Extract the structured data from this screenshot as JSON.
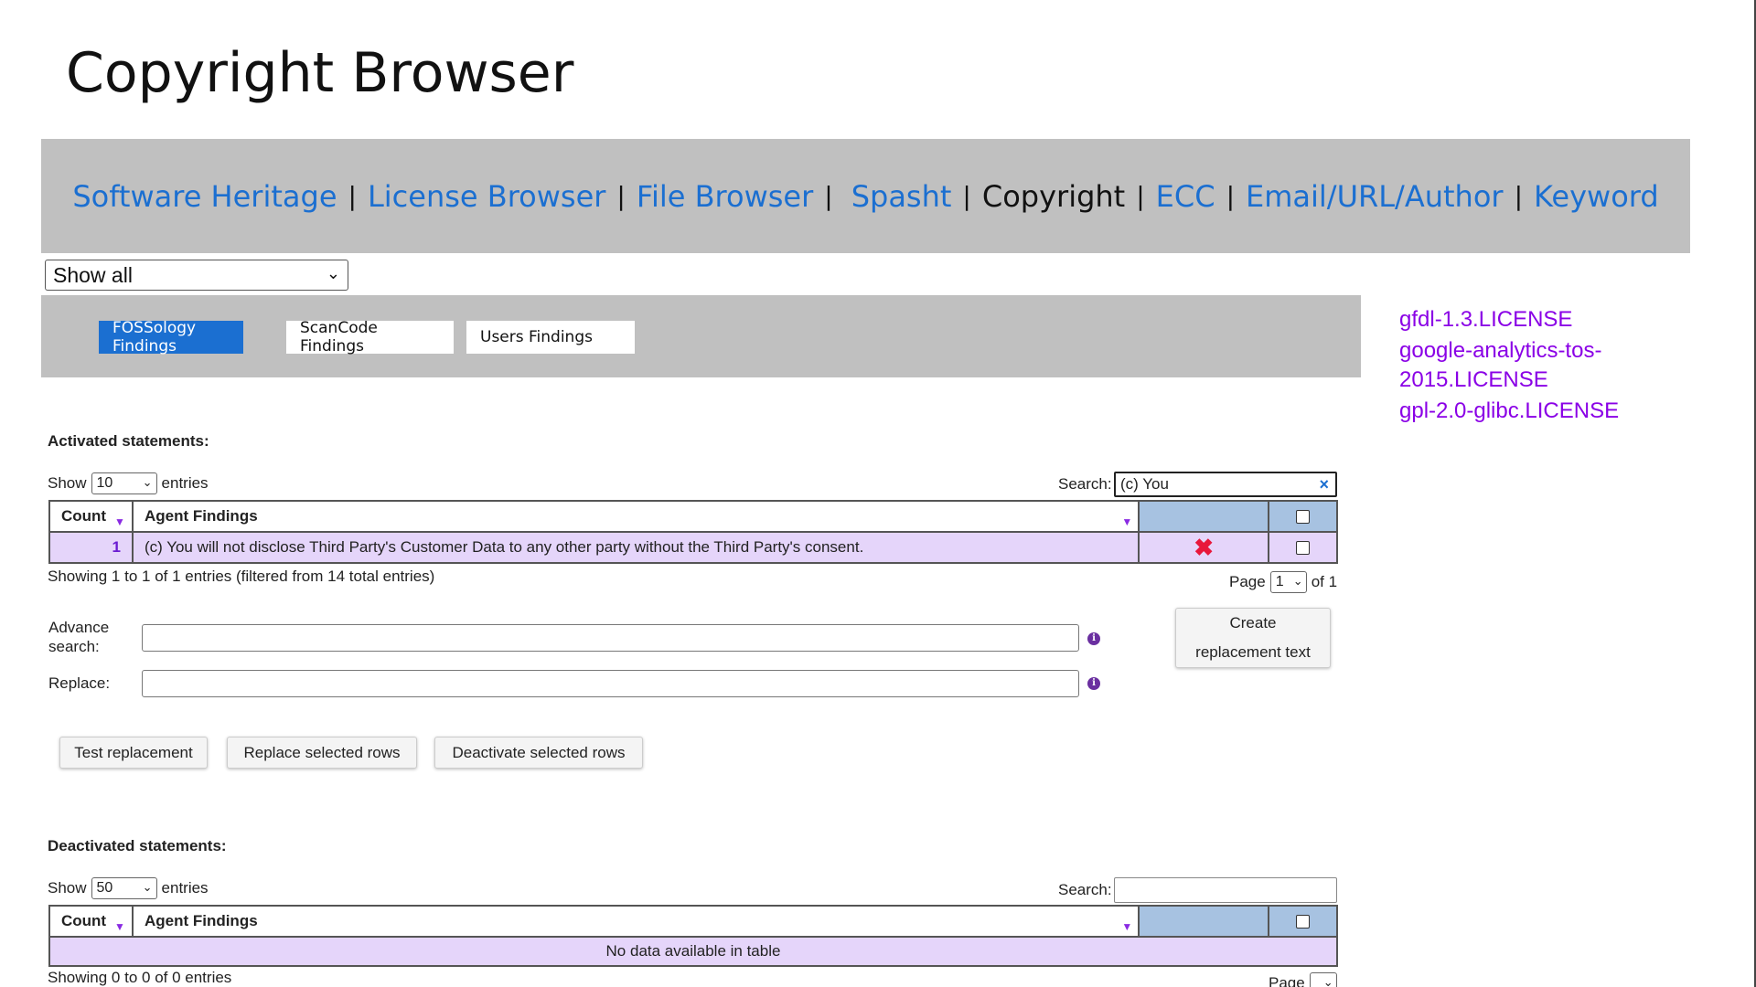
{
  "page": {
    "title": "Copyright Browser"
  },
  "nav": {
    "items": [
      {
        "label": "Software Heritage",
        "current": false
      },
      {
        "label": "License Browser",
        "current": false
      },
      {
        "label": "File Browser",
        "current": false
      },
      {
        "label": "Spasht",
        "current": false
      },
      {
        "label": "Copyright",
        "current": true
      },
      {
        "label": "ECC",
        "current": false
      },
      {
        "label": "Email/URL/Author",
        "current": false
      },
      {
        "label": "Keyword",
        "current": false
      }
    ],
    "separator": "|"
  },
  "filter": {
    "selected": "Show all"
  },
  "tabs": [
    {
      "label": "FOSSology Findings",
      "active": true
    },
    {
      "label": "ScanCode Findings",
      "active": false
    },
    {
      "label": "Users Findings",
      "active": false
    }
  ],
  "license_links": [
    "gfdl-1.3.LICENSE",
    "google-analytics-tos-2015.LICENSE",
    "gpl-2.0-glibc.LICENSE"
  ],
  "activated": {
    "heading": "Activated statements:",
    "show_label": "Show",
    "entries_label": "entries",
    "page_length": "10",
    "search_label": "Search:",
    "search_value": "(c) You",
    "columns": {
      "count": "Count",
      "findings": "Agent Findings"
    },
    "rows": [
      {
        "count": "1",
        "finding": "(c) You will not disclose Third Party's Customer Data to any other party without the Third Party's consent."
      }
    ],
    "info": "Showing 1 to 1 of 1 entries (filtered from 14 total entries)",
    "page_label": "Page",
    "page_value": "1",
    "of_label": "of 1"
  },
  "form": {
    "advance_label_1": "Advance",
    "advance_label_2": "search:",
    "replace_label": "Replace:",
    "create_btn_1": "Create",
    "create_btn_2": "replacement text",
    "info_glyph": "i"
  },
  "actions": {
    "test": "Test replacement",
    "replace": "Replace selected rows",
    "deactivate": "Deactivate selected rows"
  },
  "deactivated": {
    "heading": "Deactivated statements:",
    "show_label": "Show",
    "entries_label": "entries",
    "page_length": "50",
    "search_label": "Search:",
    "search_value": "",
    "columns": {
      "count": "Count",
      "findings": "Agent Findings"
    },
    "empty": "No data available in table",
    "info": "Showing 0 to 0 of 0 entries",
    "page_label": "Page"
  },
  "icons": {
    "sort": "▼",
    "chevron": "⌄",
    "clear": "×",
    "remove": "✖"
  },
  "colors": {
    "link_blue": "#1b6fd1",
    "license_purple": "#8a00e6",
    "nav_bg": "#c0c0c0",
    "row_bg": "#e5d5fa",
    "header_blue": "#a7c2e1",
    "remove_red": "#e8173b"
  }
}
